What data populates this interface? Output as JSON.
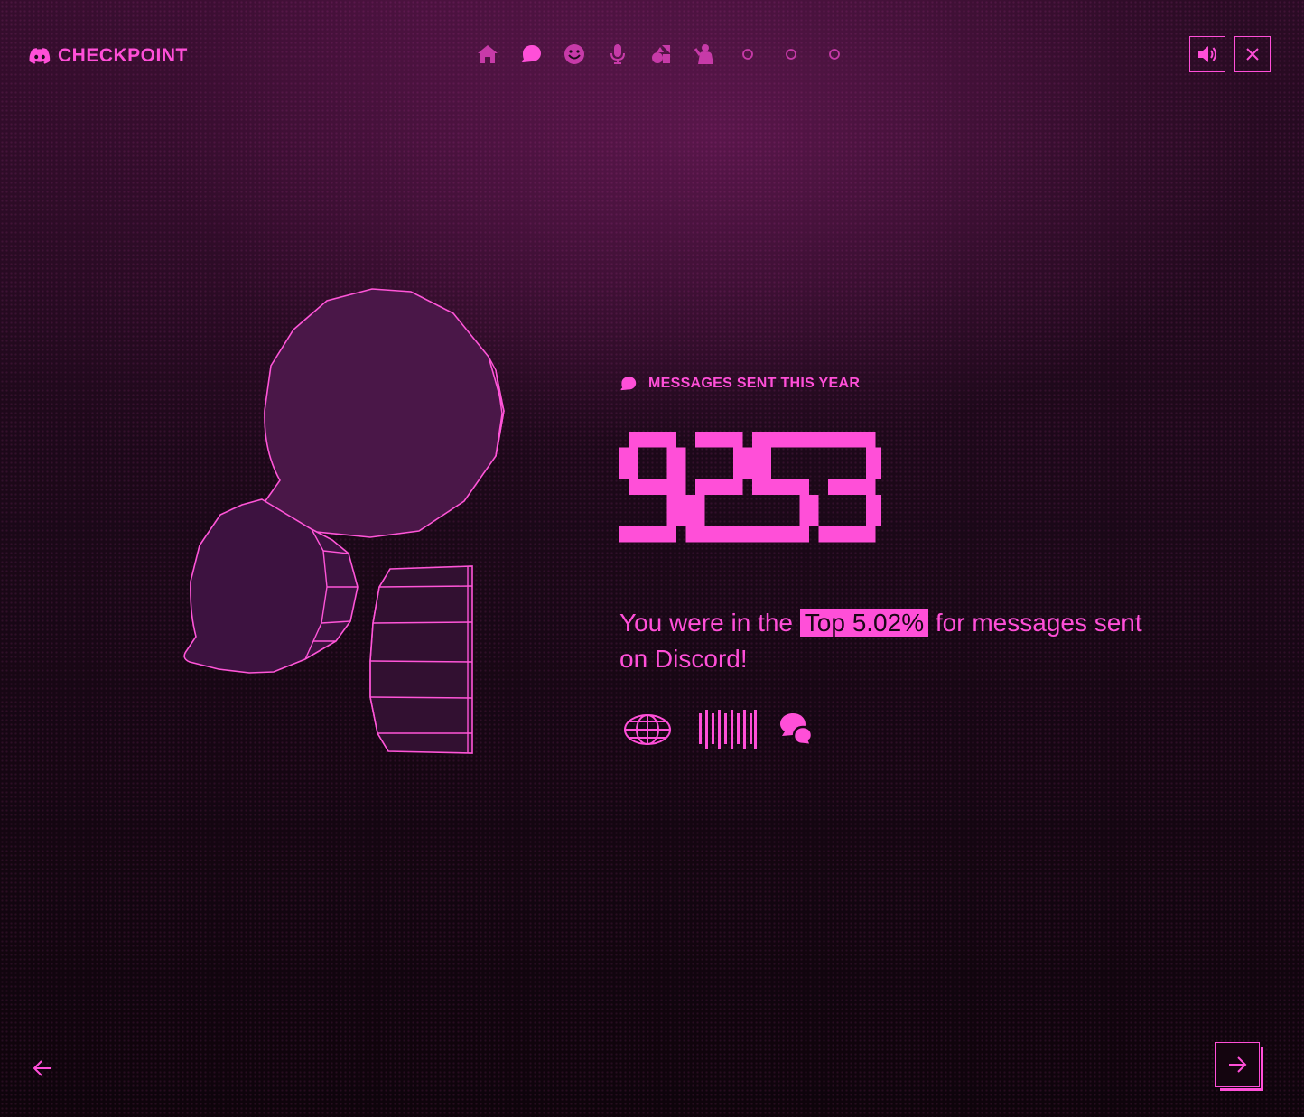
{
  "app": {
    "brand": "CHECKPOINT"
  },
  "nav": {
    "items": [
      {
        "icon": "home-icon",
        "state": "visited"
      },
      {
        "icon": "chat-bubble-icon",
        "state": "active"
      },
      {
        "icon": "smiley-icon",
        "state": "visited"
      },
      {
        "icon": "microphone-icon",
        "state": "visited"
      },
      {
        "icon": "shapes-icon",
        "state": "visited"
      },
      {
        "icon": "person-icon",
        "state": "visited"
      },
      {
        "icon": "circle-icon",
        "state": "upcoming"
      },
      {
        "icon": "circle-icon",
        "state": "upcoming"
      },
      {
        "icon": "circle-icon",
        "state": "upcoming"
      }
    ]
  },
  "header": {
    "sound_icon": "speaker-icon",
    "close_icon": "close-icon"
  },
  "stat": {
    "label": "MESSAGES SENT THIS YEAR",
    "value": "9253",
    "desc_before": "You were in the ",
    "desc_highlight": "Top 5.02%",
    "desc_after": " for messages sent on Discord!"
  },
  "badges": [
    "globe-badge-icon",
    "barcode-badge-icon",
    "chat-bubbles-badge-icon"
  ],
  "footer": {
    "prev_icon": "arrow-left-icon",
    "next_icon": "arrow-right-icon"
  },
  "colors": {
    "accent": "#ff4fd8",
    "background": "#170713",
    "muted_accent": "#c73aa8"
  }
}
